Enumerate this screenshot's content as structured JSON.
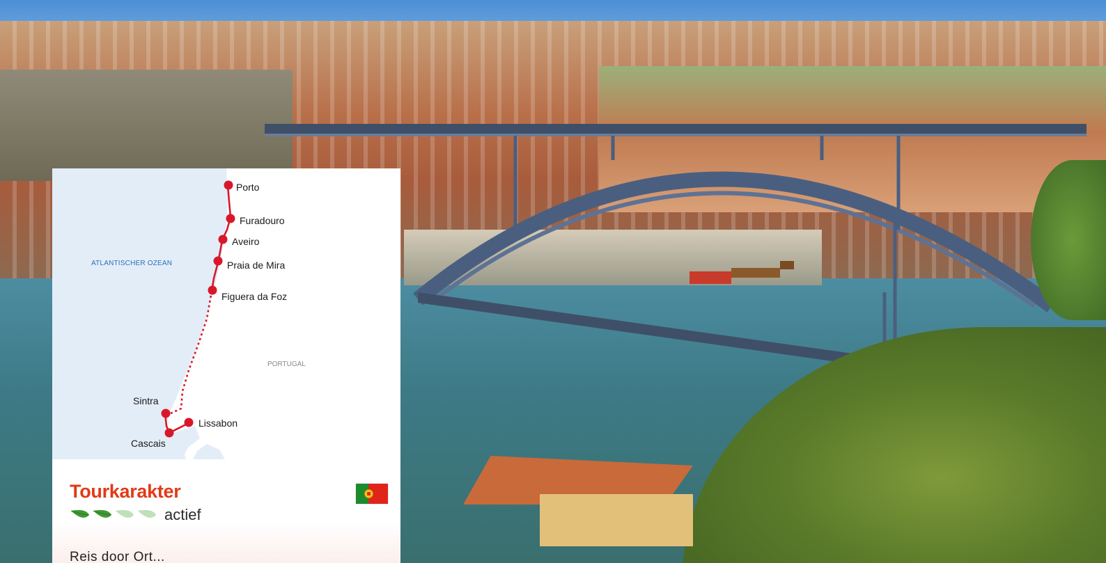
{
  "map": {
    "ocean_label": "ATLANTISCHER OZEAN",
    "country_label": "PORTUGAL",
    "stops": [
      "Porto",
      "Furadouro",
      "Aveiro",
      "Praia de Mira",
      "Figuera da Foz",
      "Sintra",
      "Lissabon",
      "Cascais"
    ],
    "route_color": "#d8182a",
    "sea_color": "#e3edf8"
  },
  "tour": {
    "title": "Tourkarakter",
    "level": "actief",
    "level_filled": 2,
    "level_max": 4,
    "flag": "portugal-flag-icon",
    "truncated_text": "Reis door Ort..."
  }
}
